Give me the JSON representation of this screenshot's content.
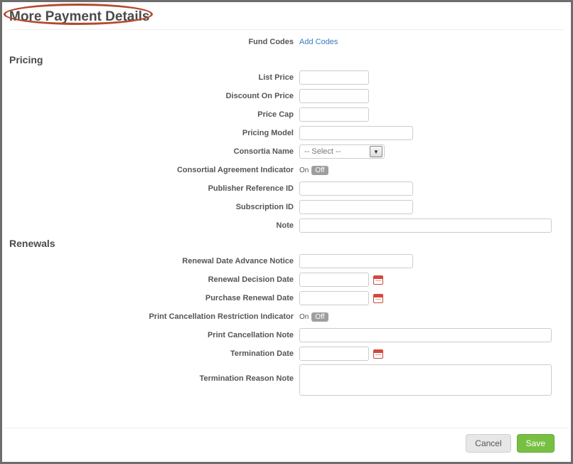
{
  "page_title": "More Payment Details",
  "fund_codes": {
    "label": "Fund Codes",
    "link_text": "Add Codes"
  },
  "pricing": {
    "section_title": "Pricing",
    "list_price": {
      "label": "List Price",
      "value": ""
    },
    "discount_on_price": {
      "label": "Discount On Price",
      "value": ""
    },
    "price_cap": {
      "label": "Price Cap",
      "value": ""
    },
    "pricing_model": {
      "label": "Pricing Model",
      "value": ""
    },
    "consortia_name": {
      "label": "Consortia Name",
      "placeholder": "-- Select --"
    },
    "consortial_agreement_indicator": {
      "label": "Consortial Agreement Indicator",
      "on_text": "On",
      "off_text": "Off"
    },
    "publisher_reference_id": {
      "label": "Publisher Reference ID",
      "value": ""
    },
    "subscription_id": {
      "label": "Subscription ID",
      "value": ""
    },
    "note": {
      "label": "Note",
      "value": ""
    }
  },
  "renewals": {
    "section_title": "Renewals",
    "renewal_date_advance_notice": {
      "label": "Renewal Date Advance Notice",
      "value": ""
    },
    "renewal_decision_date": {
      "label": "Renewal Decision Date",
      "value": ""
    },
    "purchase_renewal_date": {
      "label": "Purchase Renewal Date",
      "value": ""
    },
    "print_cancellation_restriction_indicator": {
      "label": "Print Cancellation Restriction Indicator",
      "on_text": "On",
      "off_text": "Off"
    },
    "print_cancellation_note": {
      "label": "Print Cancellation Note",
      "value": ""
    },
    "termination_date": {
      "label": "Termination Date",
      "value": ""
    },
    "termination_reason_note": {
      "label": "Termination Reason Note",
      "value": ""
    }
  },
  "footer": {
    "cancel": "Cancel",
    "save": "Save"
  }
}
